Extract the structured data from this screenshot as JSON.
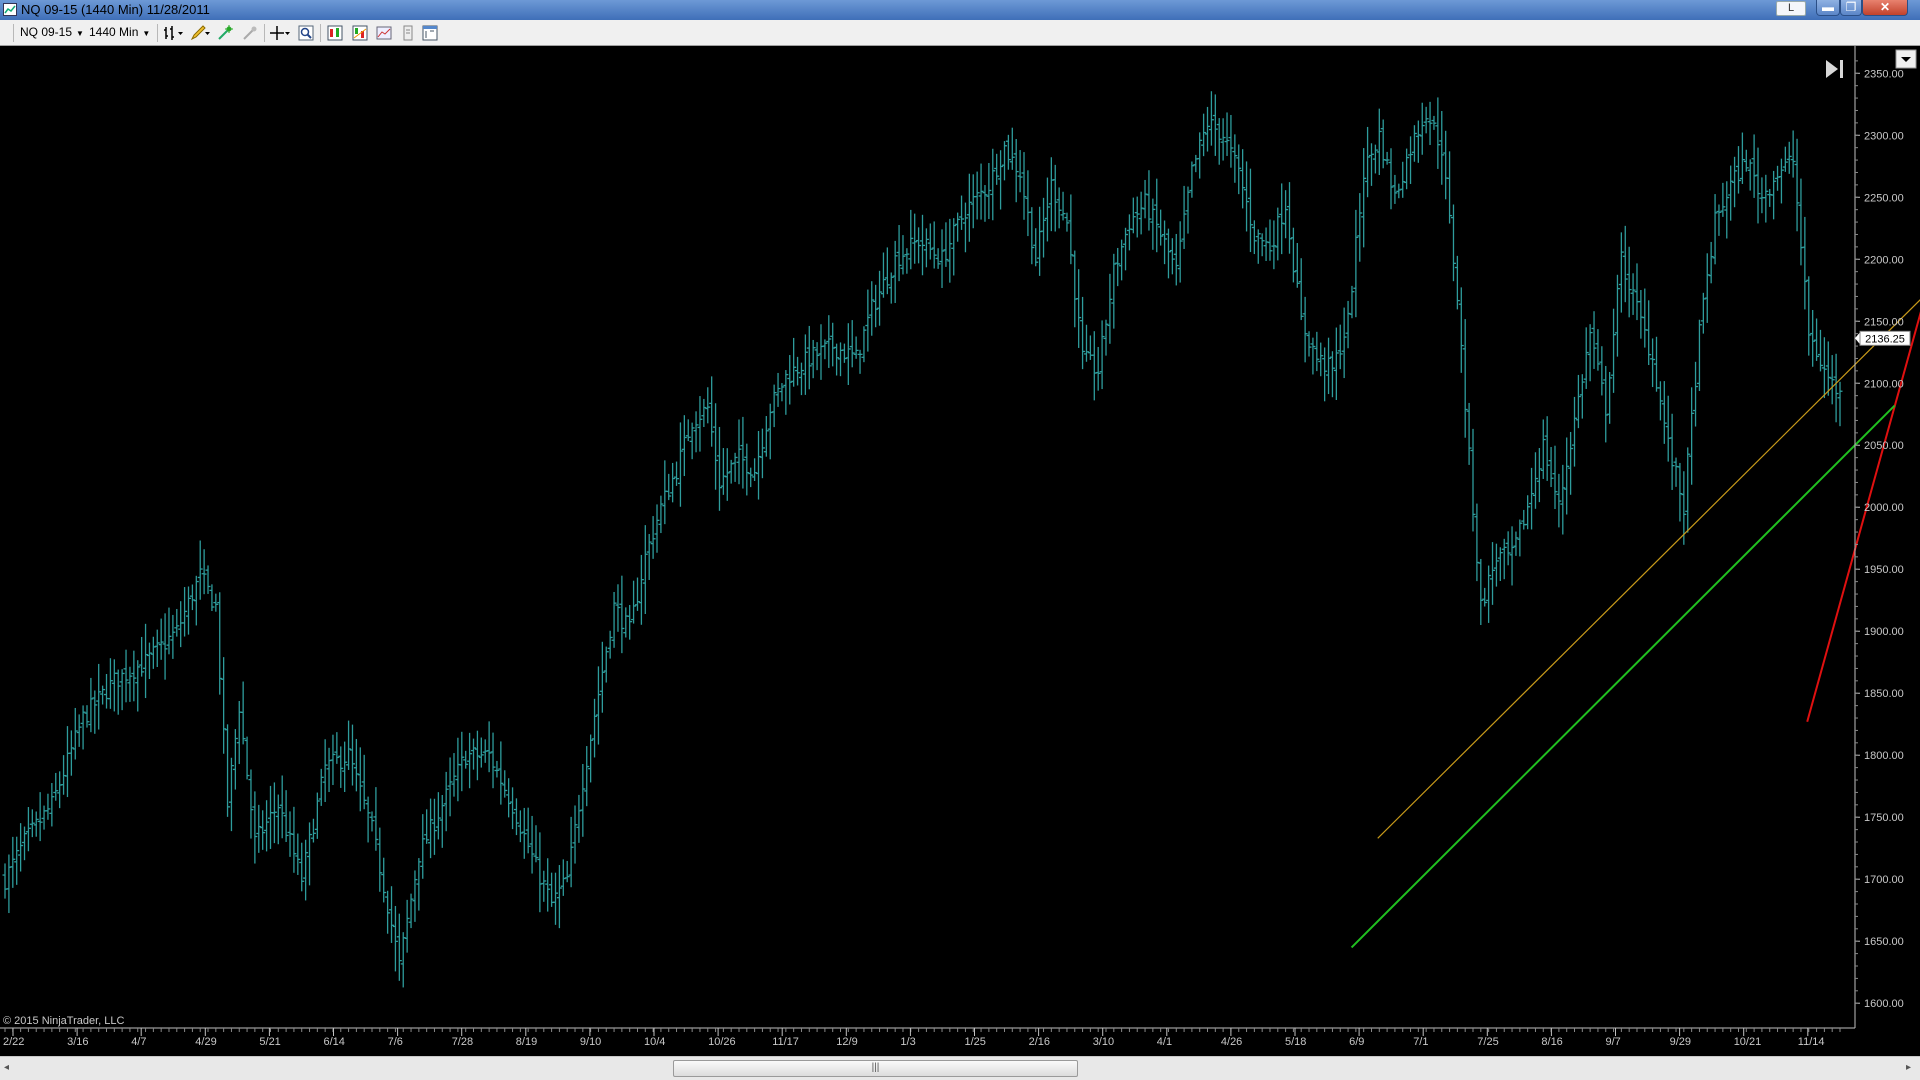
{
  "window": {
    "title": "NQ 09-15 (1440 Min)  11/28/2011",
    "btn_l": "L",
    "btn_min": "▬",
    "btn_max": "❐",
    "btn_close": "✕"
  },
  "toolbar": {
    "instrument": "NQ 09-15",
    "interval": "1440 Min",
    "icons": [
      "bar-style-icon",
      "drawing-pencil-icon",
      "drawing-tools-icon",
      "eraser-icon",
      "crosshair-icon",
      "zoom-icon",
      "strategies-icon",
      "indicators-icon",
      "data-box-icon",
      "properties-icon",
      "chart-trader-icon"
    ]
  },
  "scrollbar": {
    "grip": "|||",
    "left": "◂",
    "right": "▸"
  },
  "chart": {
    "copyright": "© 2015 NinjaTrader, LLC",
    "go_to_end_icon": "go-to-end-icon",
    "price_labels": [
      "2350.00",
      "2300.00",
      "2250.00",
      "2200.00",
      "2150.00",
      "2100.00",
      "2050.00",
      "2000.00",
      "1950.00",
      "1900.00",
      "1850.00",
      "1800.00",
      "1750.00",
      "1700.00",
      "1650.00",
      "1600.00"
    ],
    "current_price": "2136.25",
    "date_labels": [
      "2/22",
      "3/16",
      "4/7",
      "4/29",
      "5/21",
      "6/14",
      "7/6",
      "7/28",
      "8/19",
      "9/10",
      "10/4",
      "10/26",
      "11/17",
      "12/9",
      "1/3",
      "1/25",
      "2/16",
      "3/10",
      "4/1",
      "4/26",
      "5/18",
      "6/9",
      "7/1",
      "7/25",
      "8/16",
      "9/7",
      "9/29",
      "10/21",
      "11/14"
    ],
    "colors": {
      "background": "#000000",
      "bars": "#2e9c9c",
      "axis_text": "#c8c8c8",
      "channel_upper": "#e01010",
      "channel_middle": "#c89a1a",
      "channel_lower": "#20c020"
    }
  },
  "chart_data": {
    "type": "ohlc-bar",
    "ylim": [
      1580,
      2372
    ],
    "ticks": [
      2350,
      2300,
      2250,
      2200,
      2150,
      2100,
      2050,
      2000,
      1950,
      1900,
      1850,
      1800,
      1750,
      1700,
      1650,
      1600
    ],
    "last_price": 2136.25,
    "dates": [
      "2/22",
      "3/16",
      "4/7",
      "4/29",
      "5/21",
      "6/14",
      "7/6",
      "7/28",
      "8/19",
      "9/10",
      "10/4",
      "10/26",
      "11/17",
      "12/9",
      "1/3",
      "1/25",
      "2/16",
      "3/10",
      "4/1",
      "4/26",
      "5/18",
      "6/9",
      "7/1",
      "7/25",
      "8/16",
      "9/7",
      "9/29",
      "10/21",
      "11/14"
    ],
    "close_path": [
      [
        0,
        1700
      ],
      [
        5,
        1730
      ],
      [
        12,
        1760
      ],
      [
        20,
        1830
      ],
      [
        28,
        1860
      ],
      [
        36,
        1875
      ],
      [
        44,
        1900
      ],
      [
        50,
        1945
      ],
      [
        54,
        1920
      ],
      [
        57,
        1760
      ],
      [
        60,
        1840
      ],
      [
        64,
        1730
      ],
      [
        70,
        1760
      ],
      [
        76,
        1700
      ],
      [
        82,
        1790
      ],
      [
        88,
        1800
      ],
      [
        94,
        1740
      ],
      [
        98,
        1680
      ],
      [
        101,
        1630
      ],
      [
        106,
        1720
      ],
      [
        112,
        1760
      ],
      [
        118,
        1800
      ],
      [
        124,
        1800
      ],
      [
        130,
        1760
      ],
      [
        136,
        1710
      ],
      [
        140,
        1680
      ],
      [
        144,
        1700
      ],
      [
        148,
        1780
      ],
      [
        152,
        1850
      ],
      [
        156,
        1920
      ],
      [
        160,
        1900
      ],
      [
        164,
        1960
      ],
      [
        168,
        2000
      ],
      [
        172,
        2030
      ],
      [
        176,
        2070
      ],
      [
        180,
        2080
      ],
      [
        183,
        2020
      ],
      [
        188,
        2040
      ],
      [
        192,
        2030
      ],
      [
        196,
        2080
      ],
      [
        200,
        2105
      ],
      [
        206,
        2120
      ],
      [
        212,
        2130
      ],
      [
        218,
        2120
      ],
      [
        222,
        2160
      ],
      [
        228,
        2200
      ],
      [
        234,
        2215
      ],
      [
        240,
        2200
      ],
      [
        246,
        2240
      ],
      [
        252,
        2260
      ],
      [
        256,
        2290
      ],
      [
        260,
        2270
      ],
      [
        264,
        2200
      ],
      [
        268,
        2260
      ],
      [
        272,
        2230
      ],
      [
        276,
        2120
      ],
      [
        280,
        2110
      ],
      [
        284,
        2190
      ],
      [
        288,
        2230
      ],
      [
        292,
        2245
      ],
      [
        296,
        2220
      ],
      [
        300,
        2190
      ],
      [
        304,
        2270
      ],
      [
        308,
        2310
      ],
      [
        312,
        2300
      ],
      [
        316,
        2270
      ],
      [
        320,
        2220
      ],
      [
        324,
        2210
      ],
      [
        328,
        2245
      ],
      [
        332,
        2150
      ],
      [
        336,
        2120
      ],
      [
        340,
        2110
      ],
      [
        344,
        2150
      ],
      [
        348,
        2270
      ],
      [
        352,
        2300
      ],
      [
        356,
        2250
      ],
      [
        360,
        2290
      ],
      [
        364,
        2320
      ],
      [
        368,
        2290
      ],
      [
        372,
        2170
      ],
      [
        375,
        2040
      ],
      [
        378,
        1920
      ],
      [
        382,
        1960
      ],
      [
        386,
        1960
      ],
      [
        390,
        2000
      ],
      [
        394,
        2050
      ],
      [
        398,
        2000
      ],
      [
        402,
        2070
      ],
      [
        406,
        2140
      ],
      [
        410,
        2080
      ],
      [
        414,
        2200
      ],
      [
        418,
        2160
      ],
      [
        422,
        2120
      ],
      [
        426,
        2050
      ],
      [
        430,
        2000
      ],
      [
        434,
        2140
      ],
      [
        438,
        2230
      ],
      [
        442,
        2260
      ],
      [
        446,
        2280
      ],
      [
        450,
        2250
      ],
      [
        454,
        2270
      ],
      [
        458,
        2280
      ],
      [
        462,
        2140
      ],
      [
        466,
        2110
      ],
      [
        470,
        2090
      ]
    ],
    "channel": {
      "upper": [
        [
          461.6,
          1827
        ],
        [
          500,
          2263
        ]
      ],
      "middle": [
        [
          351.6,
          1733
        ],
        [
          493,
          2175
        ]
      ],
      "lower": [
        [
          344.9,
          1645
        ],
        [
          484,
          2082
        ]
      ]
    }
  }
}
